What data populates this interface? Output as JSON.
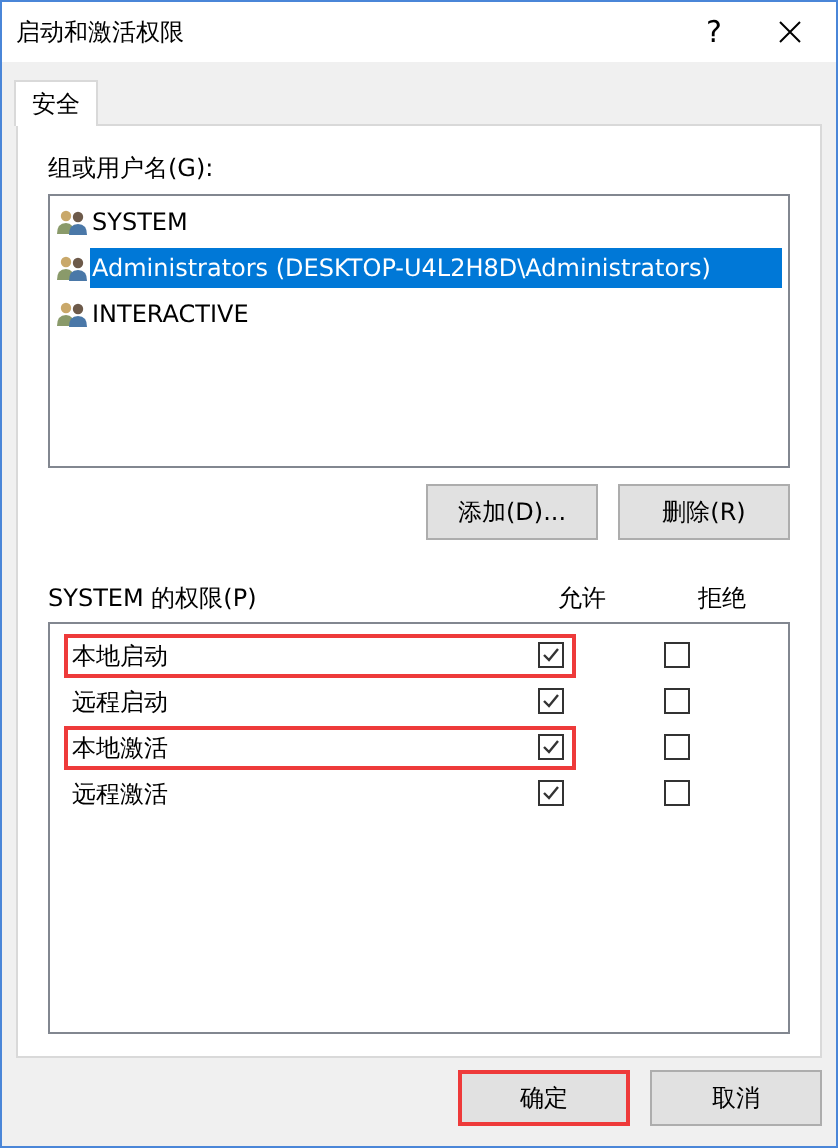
{
  "window": {
    "title": "启动和激活权限",
    "help": "?"
  },
  "tabs": [
    {
      "label": "安全",
      "selected": true
    }
  ],
  "users": {
    "label": "组或用户名(G):",
    "items": [
      {
        "name": "SYSTEM",
        "selected": false
      },
      {
        "name": "Administrators (DESKTOP-U4L2H8D\\Administrators)",
        "selected": true
      },
      {
        "name": "INTERACTIVE",
        "selected": false
      }
    ]
  },
  "user_buttons": [
    "添加(D)...",
    "删除(R)"
  ],
  "permissions": {
    "label": "SYSTEM 的权限(P)",
    "columns": [
      "允许",
      "拒绝"
    ],
    "rows": [
      {
        "name": "本地启动",
        "allow": true,
        "deny": false,
        "highlighted": true
      },
      {
        "name": "远程启动",
        "allow": true,
        "deny": false,
        "highlighted": false
      },
      {
        "name": "本地激活",
        "allow": true,
        "deny": false,
        "highlighted": true
      },
      {
        "name": "远程激活",
        "allow": true,
        "deny": false,
        "highlighted": false
      }
    ]
  },
  "footer_buttons": [
    {
      "label": "确定",
      "highlighted": true
    },
    {
      "label": "取消",
      "highlighted": false
    }
  ]
}
